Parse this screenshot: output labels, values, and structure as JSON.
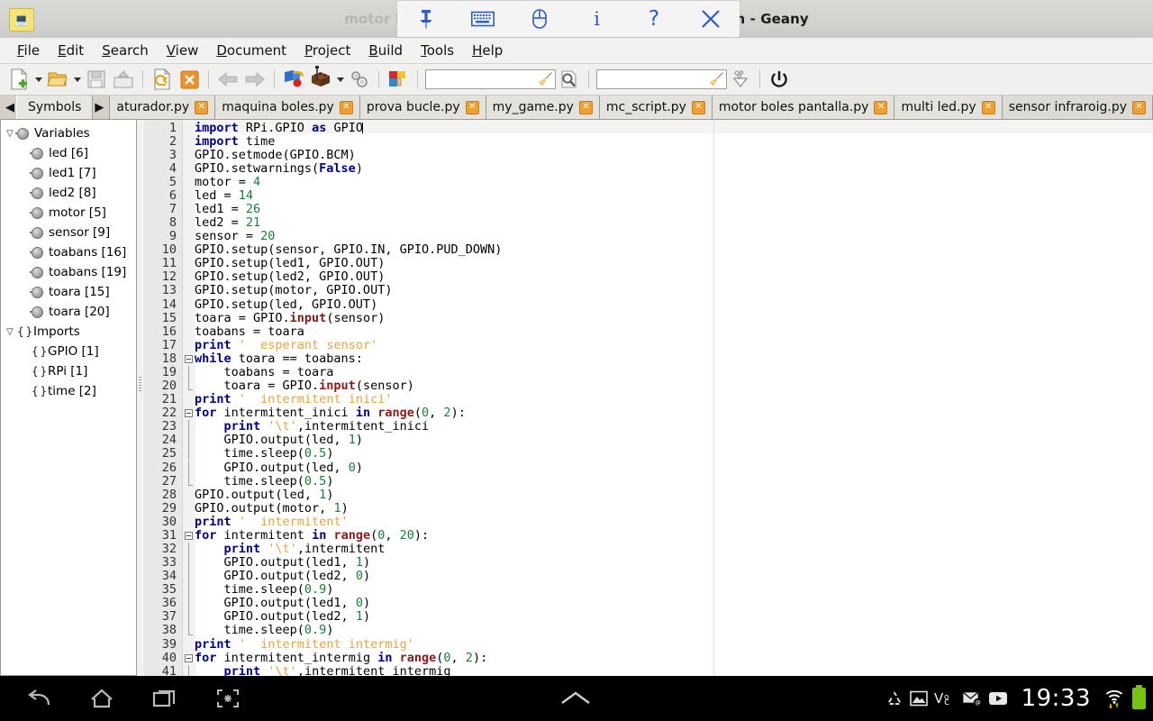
{
  "window": {
    "title_dim": "motor boles pa",
    "title": "...lla i sensor.py - /home/jofre/python - Geany",
    "app_icon": "geany-icon"
  },
  "float_toolbar": {
    "items": [
      {
        "name": "pin-icon",
        "label": "pin"
      },
      {
        "name": "keyboard-icon",
        "label": "keyboard"
      },
      {
        "name": "mouse-icon",
        "label": "mouse"
      },
      {
        "name": "info-icon",
        "label": "i"
      },
      {
        "name": "help-icon",
        "label": "?"
      },
      {
        "name": "close-icon",
        "label": "✕"
      }
    ]
  },
  "menubar": {
    "items": [
      {
        "mnemonic": "F",
        "rest": "ile"
      },
      {
        "mnemonic": "E",
        "rest": "dit"
      },
      {
        "mnemonic": "S",
        "rest": "earch"
      },
      {
        "mnemonic": "V",
        "rest": "iew"
      },
      {
        "mnemonic": "D",
        "rest": "ocument"
      },
      {
        "mnemonic": "P",
        "rest": "roject"
      },
      {
        "mnemonic": "B",
        "rest": "uild"
      },
      {
        "mnemonic": "T",
        "rest": "ools"
      },
      {
        "mnemonic": "H",
        "rest": "elp"
      }
    ]
  },
  "toolbar": {
    "search_value": "",
    "search_placeholder": "",
    "goto_value": "",
    "goto_placeholder": "",
    "buttons": [
      "new-file-button",
      "new-file-menu-arrow",
      "open-file-button",
      "open-file-menu-arrow",
      "save-button",
      "save-all-button",
      "reload-button",
      "close-button",
      "navigate-back-button",
      "navigate-forward-button",
      "compile-button",
      "build-button",
      "build-menu-arrow",
      "run-button",
      "color-chooser-button",
      "search-entry",
      "find-button",
      "goto-line-entry",
      "goto-line-button",
      "quit-button"
    ]
  },
  "sidebar": {
    "tab_label": "Symbols",
    "prev_arrow": "◀",
    "next_arrow": "▶",
    "groups": [
      {
        "name": "Variables",
        "expander": "▽",
        "icon": "variable-icon",
        "items": [
          "led [6]",
          "led1 [7]",
          "led2 [8]",
          "motor [5]",
          "sensor [9]",
          "toabans [16]",
          "toabans [19]",
          "toara [15]",
          "toara [20]"
        ]
      },
      {
        "name": "Imports",
        "expander": "▽",
        "icon": "import-icon",
        "items": [
          "GPIO [1]",
          "RPi [1]",
          "time [2]"
        ]
      }
    ]
  },
  "editor_tabs": [
    {
      "label": "aturador.py",
      "active": false
    },
    {
      "label": "maquina boles.py",
      "active": false
    },
    {
      "label": "prova bucle.py",
      "active": false
    },
    {
      "label": "my_game.py",
      "active": false
    },
    {
      "label": "mc_script.py",
      "active": false
    },
    {
      "label": "motor boles pantalla.py",
      "active": false
    },
    {
      "label": "multi led.py",
      "active": false
    },
    {
      "label": "sensor infraroig.py",
      "active": true
    }
  ],
  "code": {
    "language": "Python",
    "first_visible_line": 1,
    "last_visible_line": 41,
    "lines": [
      {
        "n": 1,
        "segs": [
          {
            "t": "import",
            "c": "k"
          },
          {
            "t": " RPi.GPIO ",
            "c": ""
          },
          {
            "t": "as",
            "c": "k"
          },
          {
            "t": " GPIO",
            "c": ""
          }
        ],
        "caret": true
      },
      {
        "n": 2,
        "segs": [
          {
            "t": "import",
            "c": "k"
          },
          {
            "t": " time",
            "c": ""
          }
        ]
      },
      {
        "n": 3,
        "segs": [
          {
            "t": "GPIO.setmode(GPIO.BCM)",
            "c": ""
          }
        ]
      },
      {
        "n": 4,
        "segs": [
          {
            "t": "GPIO.setwarnings(",
            "c": ""
          },
          {
            "t": "False",
            "c": "k"
          },
          {
            "t": ")",
            "c": ""
          }
        ]
      },
      {
        "n": 5,
        "segs": [
          {
            "t": "motor = ",
            "c": ""
          },
          {
            "t": "4",
            "c": "n"
          }
        ]
      },
      {
        "n": 6,
        "segs": [
          {
            "t": "led = ",
            "c": ""
          },
          {
            "t": "14",
            "c": "n"
          }
        ]
      },
      {
        "n": 7,
        "segs": [
          {
            "t": "led1 = ",
            "c": ""
          },
          {
            "t": "26",
            "c": "n"
          }
        ]
      },
      {
        "n": 8,
        "segs": [
          {
            "t": "led2 = ",
            "c": ""
          },
          {
            "t": "21",
            "c": "n"
          }
        ]
      },
      {
        "n": 9,
        "segs": [
          {
            "t": "sensor = ",
            "c": ""
          },
          {
            "t": "20",
            "c": "n"
          }
        ]
      },
      {
        "n": 10,
        "segs": [
          {
            "t": "GPIO.setup(sensor, GPIO.IN, GPIO.PUD_DOWN)",
            "c": ""
          }
        ]
      },
      {
        "n": 11,
        "segs": [
          {
            "t": "GPIO.setup(led1, GPIO.OUT)",
            "c": ""
          }
        ]
      },
      {
        "n": 12,
        "segs": [
          {
            "t": "GPIO.setup(led2, GPIO.OUT)",
            "c": ""
          }
        ]
      },
      {
        "n": 13,
        "segs": [
          {
            "t": "GPIO.setup(motor, GPIO.OUT)",
            "c": ""
          }
        ]
      },
      {
        "n": 14,
        "segs": [
          {
            "t": "GPIO.setup(led, GPIO.OUT)",
            "c": ""
          }
        ]
      },
      {
        "n": 15,
        "segs": [
          {
            "t": "toara = GPIO.",
            "c": ""
          },
          {
            "t": "input",
            "c": "f"
          },
          {
            "t": "(sensor)",
            "c": ""
          }
        ]
      },
      {
        "n": 16,
        "segs": [
          {
            "t": "toabans = toara",
            "c": ""
          }
        ]
      },
      {
        "n": 17,
        "segs": [
          {
            "t": "print",
            "c": "k"
          },
          {
            "t": " ",
            "c": ""
          },
          {
            "t": "'  esperant sensor'",
            "c": "s"
          }
        ]
      },
      {
        "n": 18,
        "segs": [
          {
            "t": "while",
            "c": "k"
          },
          {
            "t": " toara == toabans:",
            "c": ""
          }
        ],
        "fold": true
      },
      {
        "n": 19,
        "segs": [
          {
            "t": "    toabans = toara",
            "c": ""
          }
        ],
        "vline": true
      },
      {
        "n": 20,
        "segs": [
          {
            "t": "    toara = GPIO.",
            "c": ""
          },
          {
            "t": "input",
            "c": "f"
          },
          {
            "t": "(sensor)",
            "c": ""
          }
        ],
        "vend": true
      },
      {
        "n": 21,
        "segs": [
          {
            "t": "print",
            "c": "k"
          },
          {
            "t": " ",
            "c": ""
          },
          {
            "t": "'  intermitent inici'",
            "c": "s"
          }
        ]
      },
      {
        "n": 22,
        "segs": [
          {
            "t": "for",
            "c": "k"
          },
          {
            "t": " intermitent_inici ",
            "c": ""
          },
          {
            "t": "in",
            "c": "k"
          },
          {
            "t": " ",
            "c": ""
          },
          {
            "t": "range",
            "c": "f"
          },
          {
            "t": "(",
            "c": ""
          },
          {
            "t": "0",
            "c": "n"
          },
          {
            "t": ", ",
            "c": ""
          },
          {
            "t": "2",
            "c": "n"
          },
          {
            "t": "):",
            "c": ""
          }
        ],
        "fold": true
      },
      {
        "n": 23,
        "segs": [
          {
            "t": "    ",
            "c": ""
          },
          {
            "t": "print",
            "c": "k"
          },
          {
            "t": " ",
            "c": ""
          },
          {
            "t": "'\\t'",
            "c": "s"
          },
          {
            "t": ",intermitent_inici",
            "c": ""
          }
        ],
        "vline": true
      },
      {
        "n": 24,
        "segs": [
          {
            "t": "    GPIO.output(led, ",
            "c": ""
          },
          {
            "t": "1",
            "c": "n"
          },
          {
            "t": ")",
            "c": ""
          }
        ],
        "vline": true
      },
      {
        "n": 25,
        "segs": [
          {
            "t": "    time.sleep(",
            "c": ""
          },
          {
            "t": "0.5",
            "c": "n"
          },
          {
            "t": ")",
            "c": ""
          }
        ],
        "vline": true
      },
      {
        "n": 26,
        "segs": [
          {
            "t": "    GPIO.output(led, ",
            "c": ""
          },
          {
            "t": "0",
            "c": "n"
          },
          {
            "t": ")",
            "c": ""
          }
        ],
        "vline": true
      },
      {
        "n": 27,
        "segs": [
          {
            "t": "    time.sleep(",
            "c": ""
          },
          {
            "t": "0.5",
            "c": "n"
          },
          {
            "t": ")",
            "c": ""
          }
        ],
        "vend": true
      },
      {
        "n": 28,
        "segs": [
          {
            "t": "GPIO.output(led, ",
            "c": ""
          },
          {
            "t": "1",
            "c": "n"
          },
          {
            "t": ")",
            "c": ""
          }
        ]
      },
      {
        "n": 29,
        "segs": [
          {
            "t": "GPIO.output(motor, ",
            "c": ""
          },
          {
            "t": "1",
            "c": "n"
          },
          {
            "t": ")",
            "c": ""
          }
        ]
      },
      {
        "n": 30,
        "segs": [
          {
            "t": "print",
            "c": "k"
          },
          {
            "t": " ",
            "c": ""
          },
          {
            "t": "'  intermitent'",
            "c": "s"
          }
        ]
      },
      {
        "n": 31,
        "segs": [
          {
            "t": "for",
            "c": "k"
          },
          {
            "t": " intermitent ",
            "c": ""
          },
          {
            "t": "in",
            "c": "k"
          },
          {
            "t": " ",
            "c": ""
          },
          {
            "t": "range",
            "c": "f"
          },
          {
            "t": "(",
            "c": ""
          },
          {
            "t": "0",
            "c": "n"
          },
          {
            "t": ", ",
            "c": ""
          },
          {
            "t": "20",
            "c": "n"
          },
          {
            "t": "):",
            "c": ""
          }
        ],
        "fold": true
      },
      {
        "n": 32,
        "segs": [
          {
            "t": "    ",
            "c": ""
          },
          {
            "t": "print",
            "c": "k"
          },
          {
            "t": " ",
            "c": ""
          },
          {
            "t": "'\\t'",
            "c": "s"
          },
          {
            "t": ",intermitent",
            "c": ""
          }
        ],
        "vline": true
      },
      {
        "n": 33,
        "segs": [
          {
            "t": "    GPIO.output(led1, ",
            "c": ""
          },
          {
            "t": "1",
            "c": "n"
          },
          {
            "t": ")",
            "c": ""
          }
        ],
        "vline": true
      },
      {
        "n": 34,
        "segs": [
          {
            "t": "    GPIO.output(led2, ",
            "c": ""
          },
          {
            "t": "0",
            "c": "n"
          },
          {
            "t": ")",
            "c": ""
          }
        ],
        "vline": true
      },
      {
        "n": 35,
        "segs": [
          {
            "t": "    time.sleep(",
            "c": ""
          },
          {
            "t": "0.9",
            "c": "n"
          },
          {
            "t": ")",
            "c": ""
          }
        ],
        "vline": true
      },
      {
        "n": 36,
        "segs": [
          {
            "t": "    GPIO.output(led1, ",
            "c": ""
          },
          {
            "t": "0",
            "c": "n"
          },
          {
            "t": ")",
            "c": ""
          }
        ],
        "vline": true
      },
      {
        "n": 37,
        "segs": [
          {
            "t": "    GPIO.output(led2, ",
            "c": ""
          },
          {
            "t": "1",
            "c": "n"
          },
          {
            "t": ")",
            "c": ""
          }
        ],
        "vline": true
      },
      {
        "n": 38,
        "segs": [
          {
            "t": "    time.sleep(",
            "c": ""
          },
          {
            "t": "0.9",
            "c": "n"
          },
          {
            "t": ")",
            "c": ""
          }
        ],
        "vend": true
      },
      {
        "n": 39,
        "segs": [
          {
            "t": "print",
            "c": "k"
          },
          {
            "t": " ",
            "c": ""
          },
          {
            "t": "'  intermitent intermig'",
            "c": "s"
          }
        ]
      },
      {
        "n": 40,
        "segs": [
          {
            "t": "for",
            "c": "k"
          },
          {
            "t": " intermitent_intermig ",
            "c": ""
          },
          {
            "t": "in",
            "c": "k"
          },
          {
            "t": " ",
            "c": ""
          },
          {
            "t": "range",
            "c": "f"
          },
          {
            "t": "(",
            "c": ""
          },
          {
            "t": "0",
            "c": "n"
          },
          {
            "t": ", ",
            "c": ""
          },
          {
            "t": "2",
            "c": "n"
          },
          {
            "t": "):",
            "c": ""
          }
        ],
        "fold": true
      },
      {
        "n": 41,
        "segs": [
          {
            "t": "    ",
            "c": ""
          },
          {
            "t": "print",
            "c": "k"
          },
          {
            "t": " ",
            "c": ""
          },
          {
            "t": "'\\t'",
            "c": "s"
          },
          {
            "t": ",intermitent_intermig",
            "c": ""
          }
        ],
        "vline": true
      }
    ]
  },
  "navbar": {
    "buttons": [
      "back-icon",
      "home-icon",
      "recents-icon",
      "screenshot-icon",
      "expand-up-icon"
    ],
    "tray": [
      "recycle-icon",
      "gallery-icon",
      "vnc-icon",
      "mail-icon",
      "youtube-icon"
    ],
    "clock": "19:33",
    "wifi": "wifi-icon",
    "battery": "battery-icon"
  },
  "colors": {
    "keyword": "#00008b",
    "string": "#e8a33d",
    "number": "#1a7f37",
    "builtin": "#8b1a1a",
    "tab_close": "#f0a030",
    "accent_blue": "#2f5bc4",
    "battery_green": "#76c210"
  }
}
